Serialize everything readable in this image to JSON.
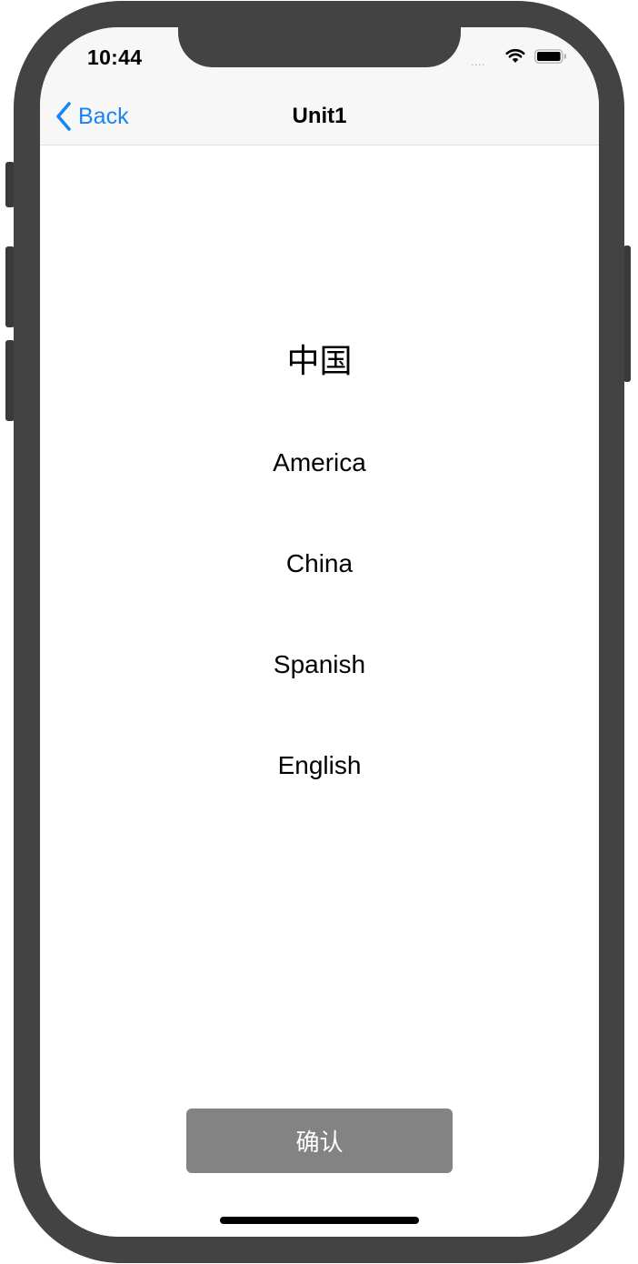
{
  "status_bar": {
    "time": "10:44",
    "signal": "....",
    "wifi_icon": "wifi-icon",
    "battery_icon": "battery-icon"
  },
  "nav": {
    "back_label": "Back",
    "back_icon": "chevron-left-icon",
    "title": "Unit1",
    "accent_color": "#1a84f4"
  },
  "quiz": {
    "question": "中国",
    "options": [
      "America",
      "China",
      "Spanish",
      "English"
    ]
  },
  "confirm": {
    "label": "确认",
    "background_color": "#838383"
  },
  "colors": {
    "frame": "#434343",
    "nav_background": "#f7f7f7"
  }
}
